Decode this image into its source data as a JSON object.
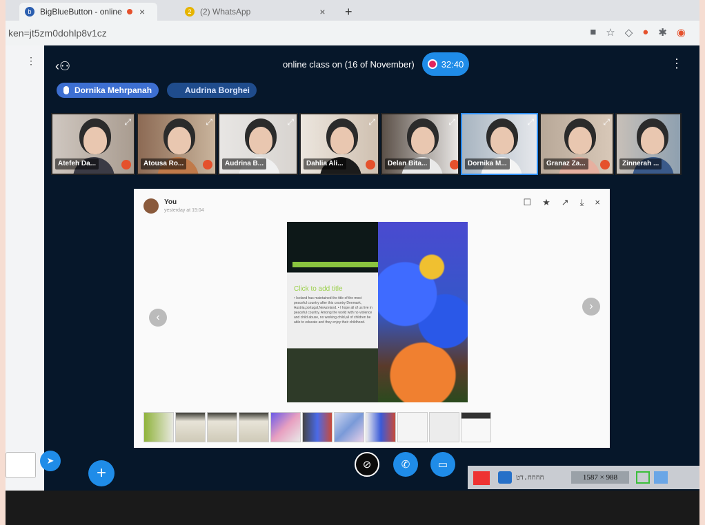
{
  "browser": {
    "tabs": [
      {
        "title": "BigBlueButton - online class",
        "close": "×"
      },
      {
        "title": "(2) WhatsApp",
        "close": "×"
      }
    ],
    "new_tab": "+",
    "url": "ken=jt5zm0dohlp8v1cz",
    "favicon_badge": "2"
  },
  "meeting": {
    "title": "online class on (16 of November)",
    "timer": "32:40",
    "talking": [
      "Dornika Mehrpanah",
      "Audrina Borghei"
    ]
  },
  "webcams": [
    {
      "name": "Atefeh Da..."
    },
    {
      "name": "Atousa Ro..."
    },
    {
      "name": "Audrina B..."
    },
    {
      "name": "Dahlia Ali..."
    },
    {
      "name": "Delan Bita..."
    },
    {
      "name": "Dornika M..."
    },
    {
      "name": "Granaz Za..."
    },
    {
      "name": "Zinnerah ..."
    }
  ],
  "presentation": {
    "sender": "You",
    "time": "yesterday at 15:04",
    "slide_title": "Click to add title",
    "slide_text": "• Iceland has maintained the title of the most peaceful country after this country Denmark, Austria,portugal,Newzeland. • I hope all of us live in peaceful country. Among the world with no violence and child abuse, no working child,all of children be able to educate and they enjoy their childhood.",
    "tools": [
      "☐",
      "★",
      "↗",
      "⤓",
      "×"
    ]
  },
  "taskbar": {
    "app_text": "חחחח.דט",
    "resolution": "1587 × 988"
  },
  "icons": {
    "users_toggle": "users-icon",
    "options": "kebab-icon",
    "mute": "muted-mic-icon",
    "audio": "phone-icon",
    "camera": "video-camera-icon",
    "plus": "plus-icon",
    "send": "send-icon"
  },
  "colors": {
    "accent": "#1f8ce8",
    "app_bg": "#06172a",
    "talker": "#3d6fd1"
  }
}
